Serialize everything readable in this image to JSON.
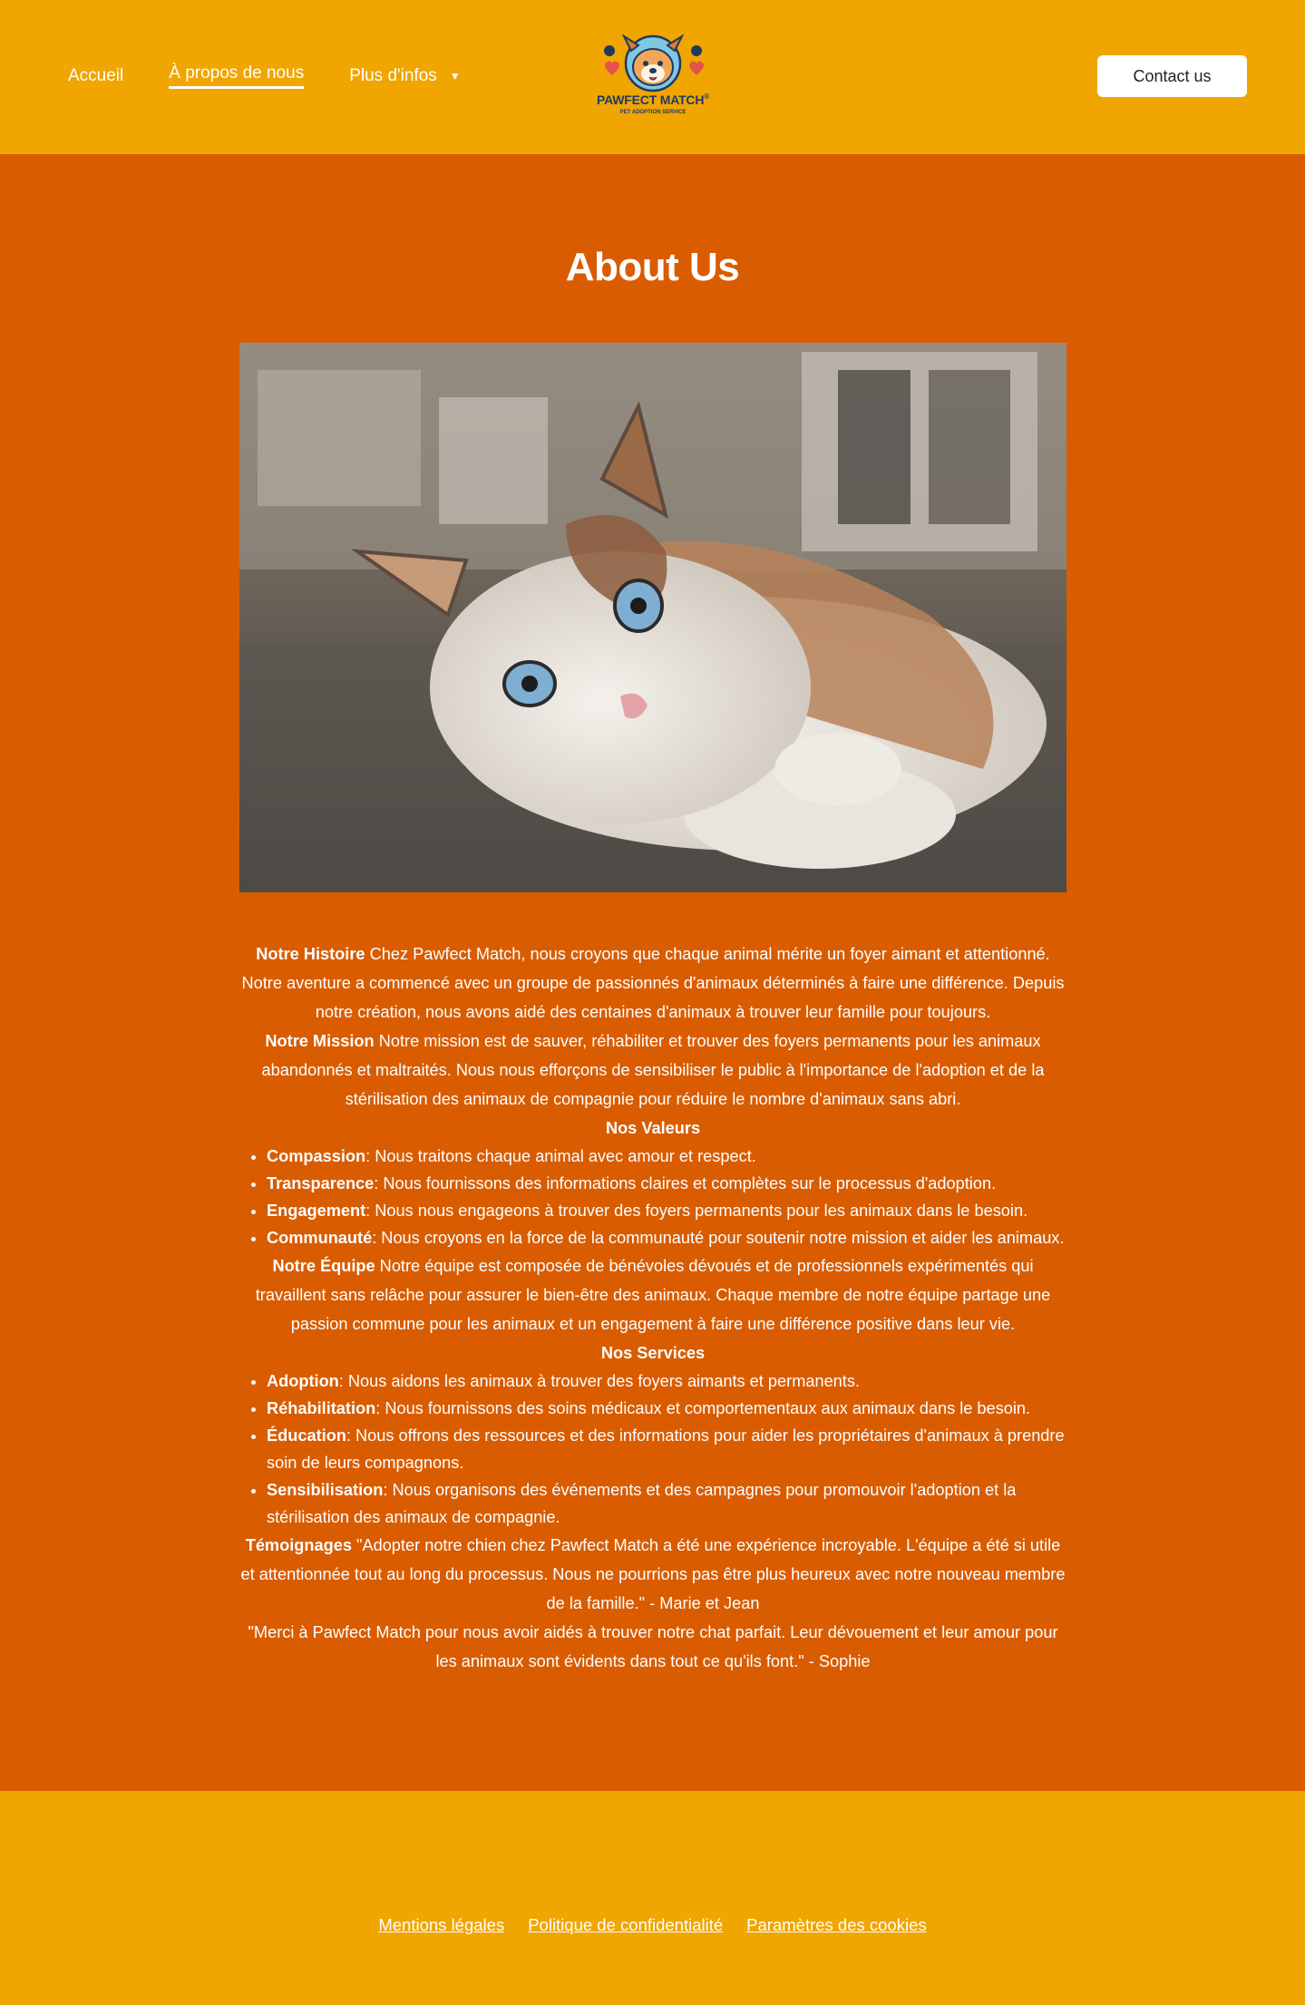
{
  "header": {
    "nav": [
      {
        "label": "Accueil"
      },
      {
        "label": "À propos de nous"
      },
      {
        "label": "Plus d'infos"
      }
    ],
    "logo": {
      "name": "PAWFECT MATCH",
      "tagline": "PET ADOPTION SERVICE",
      "mark": "®"
    },
    "contact_label": "Contact us"
  },
  "main": {
    "title": "About Us",
    "histoire": {
      "heading": "Notre Histoire",
      "text": " Chez Pawfect Match, nous croyons que chaque animal mérite un foyer aimant et attentionné. Notre aventure a commencé avec un groupe de passionnés d'animaux déterminés à faire une différence. Depuis notre création, nous avons aidé des centaines d'animaux à trouver leur famille pour toujours."
    },
    "mission": {
      "heading": "Notre Mission",
      "text": " Notre mission est de sauver, réhabiliter et trouver des foyers permanents pour les animaux abandonnés et maltraités. Nous nous efforçons de sensibiliser le public à l'importance de l'adoption et de la stérilisation des animaux de compagnie pour réduire le nombre d'animaux sans abri."
    },
    "valeurs": {
      "heading": "Nos Valeurs",
      "items": [
        {
          "term": "Compassion",
          "text": ": Nous traitons chaque animal avec amour et respect."
        },
        {
          "term": "Transparence",
          "text": ": Nous fournissons des informations claires et complètes sur le processus d'adoption."
        },
        {
          "term": "Engagement",
          "text": ": Nous nous engageons à trouver des foyers permanents pour les animaux dans le besoin."
        },
        {
          "term": "Communauté",
          "text": ": Nous croyons en la force de la communauté pour soutenir notre mission et aider les animaux."
        }
      ]
    },
    "equipe": {
      "heading": "Notre Équipe",
      "text": " Notre équipe est composée de bénévoles dévoués et de professionnels expérimentés qui travaillent sans relâche pour assurer le bien-être des animaux. Chaque membre de notre équipe partage une passion commune pour les animaux et un engagement à faire une différence positive dans leur vie."
    },
    "services": {
      "heading": "Nos Services",
      "items": [
        {
          "term": "Adoption",
          "text": ": Nous aidons les animaux à trouver des foyers aimants et permanents."
        },
        {
          "term": "Réhabilitation",
          "text": ": Nous fournissons des soins médicaux et comportementaux aux animaux dans le besoin."
        },
        {
          "term": "Éducation",
          "text": ": Nous offrons des ressources et des informations pour aider les propriétaires d'animaux à prendre soin de leurs compagnons."
        },
        {
          "term": "Sensibilisation",
          "text": ": Nous organisons des événements et des campagnes pour promouvoir l'adoption et la stérilisation des animaux de compagnie."
        }
      ]
    },
    "temoignages": {
      "heading": "Témoignages",
      "quote1": " \"Adopter notre chien chez Pawfect Match a été une expérience incroyable. L'équipe a été si utile et attentionnée tout au long du processus. Nous ne pourrions pas être plus heureux avec notre nouveau membre de la famille.\" - Marie et Jean",
      "quote2": "\"Merci à Pawfect Match pour nous avoir aidés à trouver notre chat parfait. Leur dévouement et leur amour pour les animaux sont évidents dans tout ce qu'ils font.\" - Sophie"
    }
  },
  "footer": {
    "links": [
      {
        "label": "Mentions légales"
      },
      {
        "label": "Politique de confidentialité"
      },
      {
        "label": "Paramètres des cookies"
      }
    ]
  },
  "colors": {
    "header_bg": "#f0a500",
    "main_bg": "#d95c00",
    "footer_bg": "#f0a500"
  }
}
